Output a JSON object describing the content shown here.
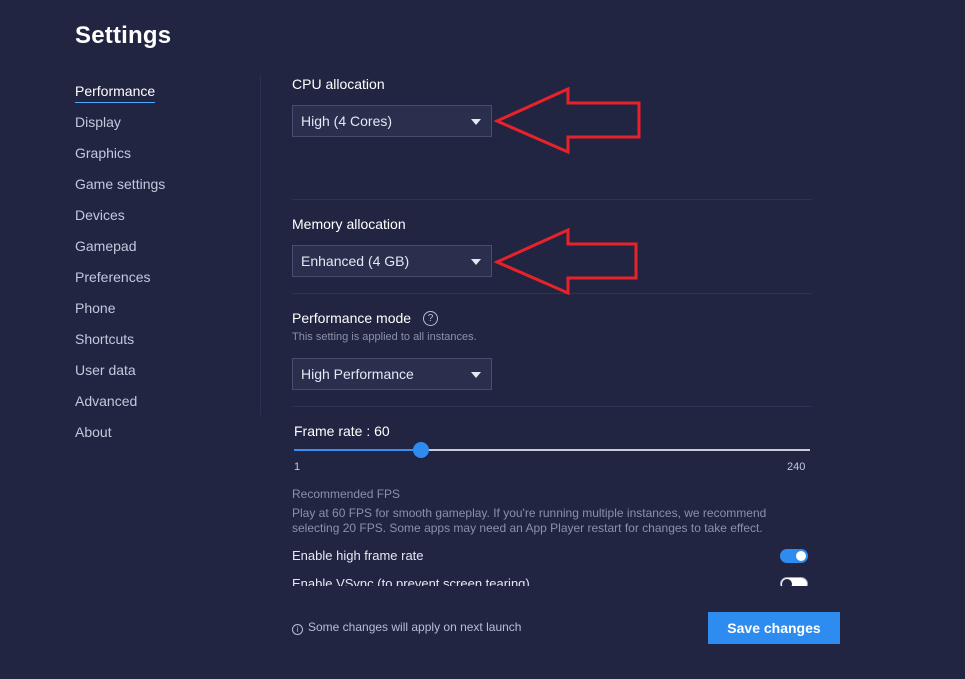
{
  "title": "Settings",
  "sidebar": {
    "items": [
      {
        "label": "Performance",
        "active": true
      },
      {
        "label": "Display"
      },
      {
        "label": "Graphics"
      },
      {
        "label": "Game settings"
      },
      {
        "label": "Devices"
      },
      {
        "label": "Gamepad"
      },
      {
        "label": "Preferences"
      },
      {
        "label": "Phone"
      },
      {
        "label": "Shortcuts"
      },
      {
        "label": "User data"
      },
      {
        "label": "Advanced"
      },
      {
        "label": "About"
      }
    ]
  },
  "cpu": {
    "label": "CPU allocation",
    "value": "High (4 Cores)"
  },
  "memory": {
    "label": "Memory allocation",
    "value": "Enhanced (4 GB)"
  },
  "performance_mode": {
    "label": "Performance mode",
    "help_icon": "?",
    "note": "This setting is applied to all instances.",
    "value": "High Performance"
  },
  "frame_rate": {
    "label": "Frame rate : 60",
    "value": 60,
    "min_label": "1",
    "max_label": "240"
  },
  "recommended": {
    "title": "Recommended FPS",
    "text": "Play at 60 FPS for smooth gameplay. If you're running multiple instances, we recommend selecting 20 FPS. Some apps may need an App Player restart for changes to take effect."
  },
  "toggles": {
    "high_frame_rate": {
      "label": "Enable high frame rate",
      "on": true
    },
    "vsync": {
      "label": "Enable VSync (to prevent screen tearing)",
      "on": false
    }
  },
  "footer": {
    "info_icon": "i",
    "note": "Some changes will apply on next launch",
    "save_label": "Save changes"
  },
  "colors": {
    "background": "#212542",
    "accent": "#2e8cf0",
    "annotation_arrow": "#e8222a"
  }
}
